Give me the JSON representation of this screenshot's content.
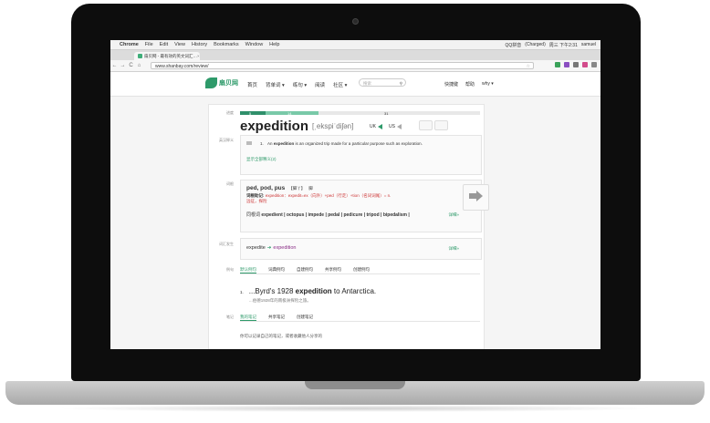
{
  "os_menubar": {
    "apple": "",
    "items": [
      "Chrome",
      "File",
      "Edit",
      "View",
      "History",
      "Bookmarks",
      "Window",
      "Help"
    ],
    "right": [
      "QQ拼音",
      "(Charged)",
      "周三 下午2:31",
      "samuel"
    ]
  },
  "browser": {
    "tab_title": "扇贝网 - 最有效的英文词汇…",
    "url": "www.shanbay.com/review/",
    "back": "←",
    "forward": "→",
    "reload": "C",
    "home": "⌂",
    "star": "☆"
  },
  "site": {
    "logo_text": "扇贝网",
    "nav": [
      "首页",
      "背单词 ▾",
      "练句 ▾",
      "阅读",
      "社区 ▾"
    ],
    "search_placeholder": "搜索",
    "header_right": [
      "快捷键",
      "帮助",
      "why ▾"
    ]
  },
  "review": {
    "progress_label": "进度",
    "progress_values": [
      "5",
      "14",
      "31"
    ],
    "word": "expedition",
    "phonetic": "[ˌekspiˈdiʃən]",
    "uk_label": "UK",
    "us_label": "US",
    "def_label": "英汉释义",
    "def_num": "1.",
    "definition_before": "An ",
    "definition_word": "expedition",
    "definition_after": " is an organized trip made for a particular purpose such as exploration.",
    "show_all": "显示全部释义(2)",
    "root_label": "词根",
    "roots": "ped, pod, pus",
    "root_tag": "【脚丫】",
    "root_extra": "脚",
    "root_mnemonic_label": "词根助记:",
    "root_mnemonic": "expedition：expedit=ex（向外）+ped（行走）+tion（名词词尾）= n. 远征，探险",
    "same_root_label": "同根词",
    "same_root_words": "expedient | octopus | impede | pedal | pedicure | tripod | bipedalism |",
    "detail_link": "详细»",
    "deriv_label": "词汇发生",
    "deriv_from": "expedite",
    "deriv_arrow": "➔",
    "deriv_to": "expedition",
    "deriv_detail": "详细»",
    "example_label": "例句",
    "example_tabs": [
      "默认例句",
      "词典例句",
      "自建例句",
      "共享例句",
      "创建例句"
    ],
    "example_num": "1.",
    "example_before": "...Byrd's 1928 ",
    "example_word": "expedition",
    "example_after": " to Antarctica.",
    "example_translation": "...伯德1928年的南极洲探险之旅。",
    "notes_label": "笔记",
    "note_tabs": [
      "我的笔记",
      "共享笔记",
      "创建笔记"
    ],
    "notes_hint": "你可以记录自己的笔记，或者收藏他人分享的"
  },
  "colors": {
    "brand_green": "#2e9a6a",
    "progress_light": "#79c9a8",
    "root_red": "#cc3333",
    "deriv_purple": "#8a2e86"
  }
}
